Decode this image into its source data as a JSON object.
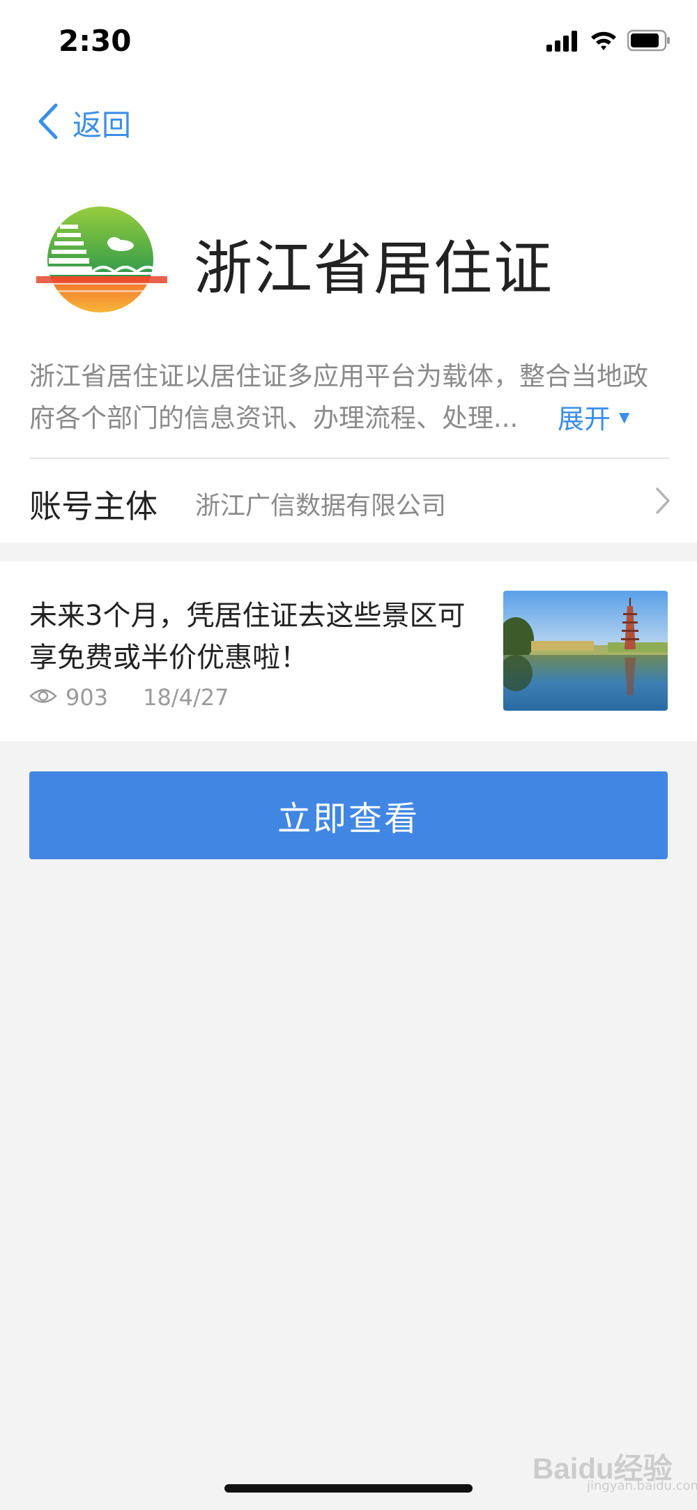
{
  "status_bar": {
    "time": "2:30"
  },
  "nav": {
    "back_label": "返回"
  },
  "app": {
    "title": "浙江省居住证",
    "description_line1": "浙江省居住证以居住证多应用平台为载体，整合当地政",
    "description_line2": "府各个部门的信息资讯、办理流程、处理...",
    "expand_label": "展开"
  },
  "account": {
    "label": "账号主体",
    "value": "浙江广信数据有限公司"
  },
  "article": {
    "title": "未来3个月，凭居住证去这些景区可享免费或半价优惠啦！",
    "views": "903",
    "date": "18/4/27"
  },
  "action": {
    "label": "立即查看"
  },
  "watermark": {
    "brand": "Baidu经验",
    "sub": "jingyan.baidu.com"
  },
  "colors": {
    "accent": "#3b8ee8",
    "button": "#4186e2",
    "background": "#f3f3f3",
    "secondary_text": "#8a8a8a"
  }
}
